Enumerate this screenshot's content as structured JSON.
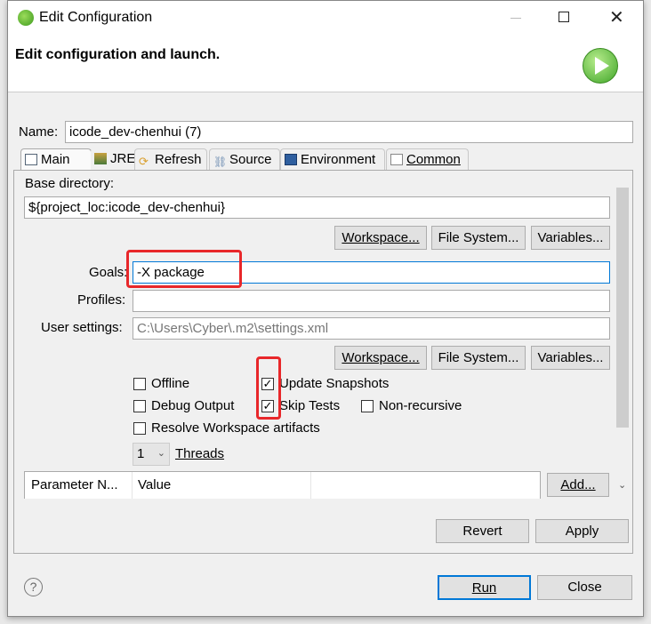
{
  "window": {
    "title": "Edit Configuration",
    "header": "Edit configuration and launch."
  },
  "name": {
    "label": "Name:",
    "value": "icode_dev-chenhui (7)"
  },
  "tabs": [
    {
      "label": "Main"
    },
    {
      "label": "JRE"
    },
    {
      "label": "Refresh"
    },
    {
      "label": "Source"
    },
    {
      "label": "Environment"
    },
    {
      "label": "Common"
    }
  ],
  "main": {
    "base_dir_label": "Base directory:",
    "base_dir_value": "${project_loc:icode_dev-chenhui}",
    "workspace": "Workspace...",
    "file_system": "File System...",
    "variables": "Variables...",
    "goals_label": "Goals:",
    "goals_value": "-X package",
    "profiles_label": "Profiles:",
    "profiles_value": "",
    "user_settings_label": "User settings:",
    "user_settings_value": "C:\\Users\\Cyber\\.m2\\settings.xml",
    "checkboxes": {
      "offline": "Offline",
      "update_snapshots": "Update Snapshots",
      "debug_output": "Debug Output",
      "skip_tests": "Skip Tests",
      "non_recursive": "Non-recursive",
      "resolve_workspace": "Resolve Workspace artifacts"
    },
    "checked": {
      "offline": false,
      "update_snapshots": true,
      "debug_output": false,
      "skip_tests": true,
      "non_recursive": false,
      "resolve_workspace": false
    },
    "threads_value": "1",
    "threads_label": "Threads",
    "table_headers": [
      "Parameter N...",
      "Value"
    ],
    "add": "Add..."
  },
  "buttons": {
    "revert": "Revert",
    "apply": "Apply",
    "run": "Run",
    "close": "Close"
  },
  "colors": {
    "highlight": "#e8272a",
    "default_button_border": "#0078d7"
  }
}
